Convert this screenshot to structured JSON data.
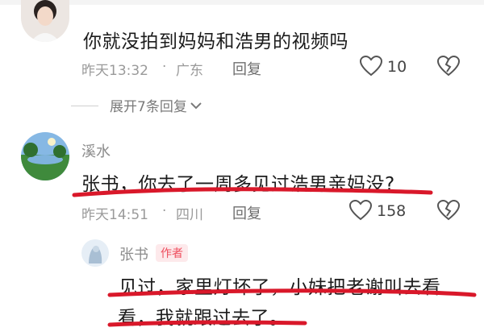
{
  "comments": [
    {
      "text": "你就没拍到妈妈和浩男的视频吗",
      "time": "昨天13:32",
      "sep": "·",
      "location": "广东",
      "reply_label": "回复",
      "likes": "10"
    },
    {
      "username": "溪水",
      "text": "张书，你去了一周多见过浩男亲妈没?",
      "time": "昨天14:51",
      "sep": "·",
      "location": "四川",
      "reply_label": "回复",
      "likes": "158"
    }
  ],
  "expand_replies": {
    "label": "展开7条回复"
  },
  "reply": {
    "username": "张书",
    "author_badge": "作者",
    "text_line1": "见过，家里灯坏了，小妹把老谢叫去看",
    "text_line2": "看，我就跟过去了。"
  },
  "colors": {
    "underline_red": "#d9182a",
    "badge_red": "#ee4d5d",
    "meta_gray": "#9a9a9a",
    "icon_gray": "#555555"
  },
  "icons": {
    "like": "heart-outline-icon",
    "dislike": "broken-heart-outline-icon",
    "expand": "chevron-down-icon"
  }
}
